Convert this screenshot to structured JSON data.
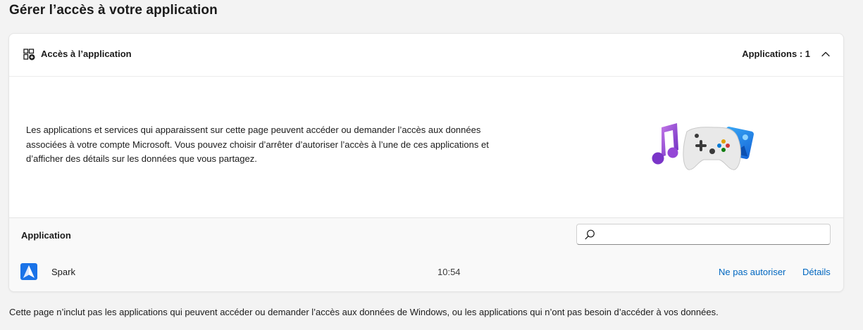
{
  "page": {
    "title": "Gérer l’accès à votre application"
  },
  "section": {
    "header_label": "Accès à l’application",
    "count_label": "Applications : 1",
    "icon": "app-access-icon",
    "chevron": "chevron-up-icon",
    "description": "Les applications et services qui apparaissent sur cette page peuvent accéder ou demander l’accès aux données associées à votre compte Microsoft. Vous pouvez choisir d’arrêter d’autoriser l’accès à l’une de ces applications et d’afficher des détails sur les données que vous partagez.",
    "illustration": "apps-illustration"
  },
  "table": {
    "column_label": "Application",
    "search": {
      "value": "",
      "placeholder": "",
      "icon": "search-icon"
    },
    "rows": [
      {
        "name": "Spark",
        "time": "10:54",
        "deny_label": "Ne pas autoriser",
        "details_label": "Détails",
        "logo": "spark-logo"
      }
    ]
  },
  "footer": {
    "note": "Cette page n’inclut pas les applications qui peuvent accéder ou demander l’accès aux données de Windows, ou les applications qui n’ont pas besoin d’accéder à vos données."
  },
  "colors": {
    "accent": "#0067c0",
    "background": "#f3f3f3",
    "card": "#ffffff"
  }
}
